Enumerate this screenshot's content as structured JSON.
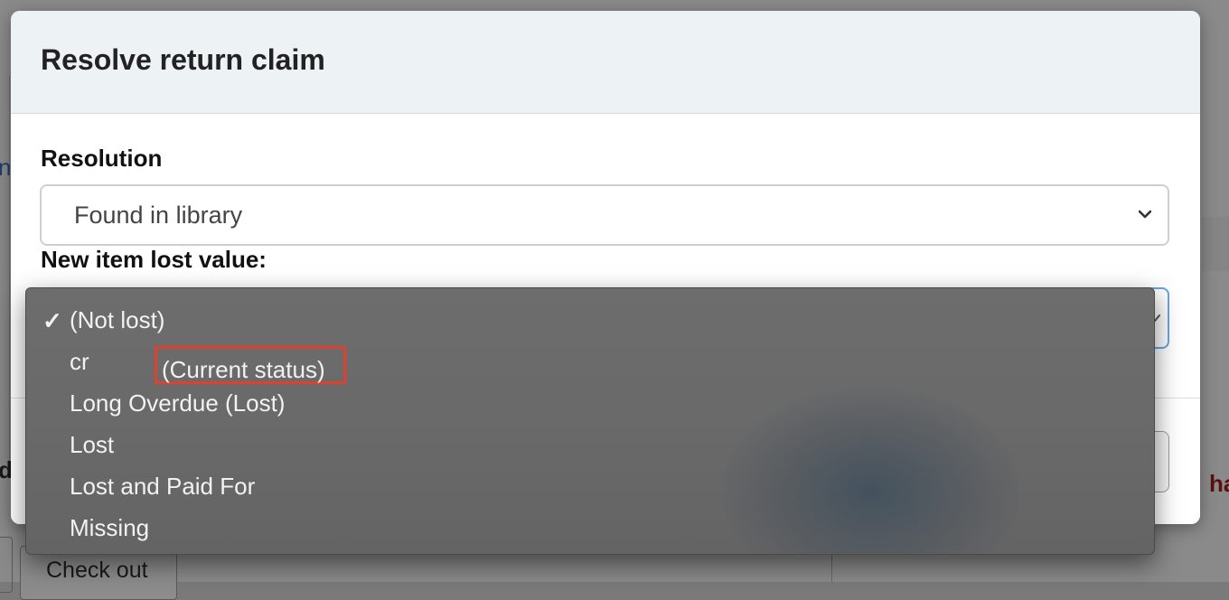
{
  "background": {
    "link_fragment": "n",
    "bold_fragment_left": "d",
    "bold_fragment_right": "ha",
    "checkout_button_label": "Check out"
  },
  "modal": {
    "title": "Resolve return claim",
    "resolution": {
      "label": "Resolution",
      "selected": "Found in library"
    },
    "lost_value": {
      "label": "New item lost value:",
      "options": [
        {
          "label": "(Not lost)",
          "checked": true
        },
        {
          "label": "cr",
          "note": "(Current status)",
          "checked": false
        },
        {
          "label": "Long Overdue (Lost)",
          "checked": false
        },
        {
          "label": "Lost",
          "checked": false
        },
        {
          "label": "Lost and Paid For",
          "checked": false
        },
        {
          "label": "Missing",
          "checked": false
        }
      ],
      "check_glyph": "✓"
    }
  },
  "colors": {
    "header_bg": "#edf2f5",
    "highlight_box": "#e0402e",
    "dropdown_bg": "#6a6a6a",
    "focus_border": "#6aa6dc"
  }
}
